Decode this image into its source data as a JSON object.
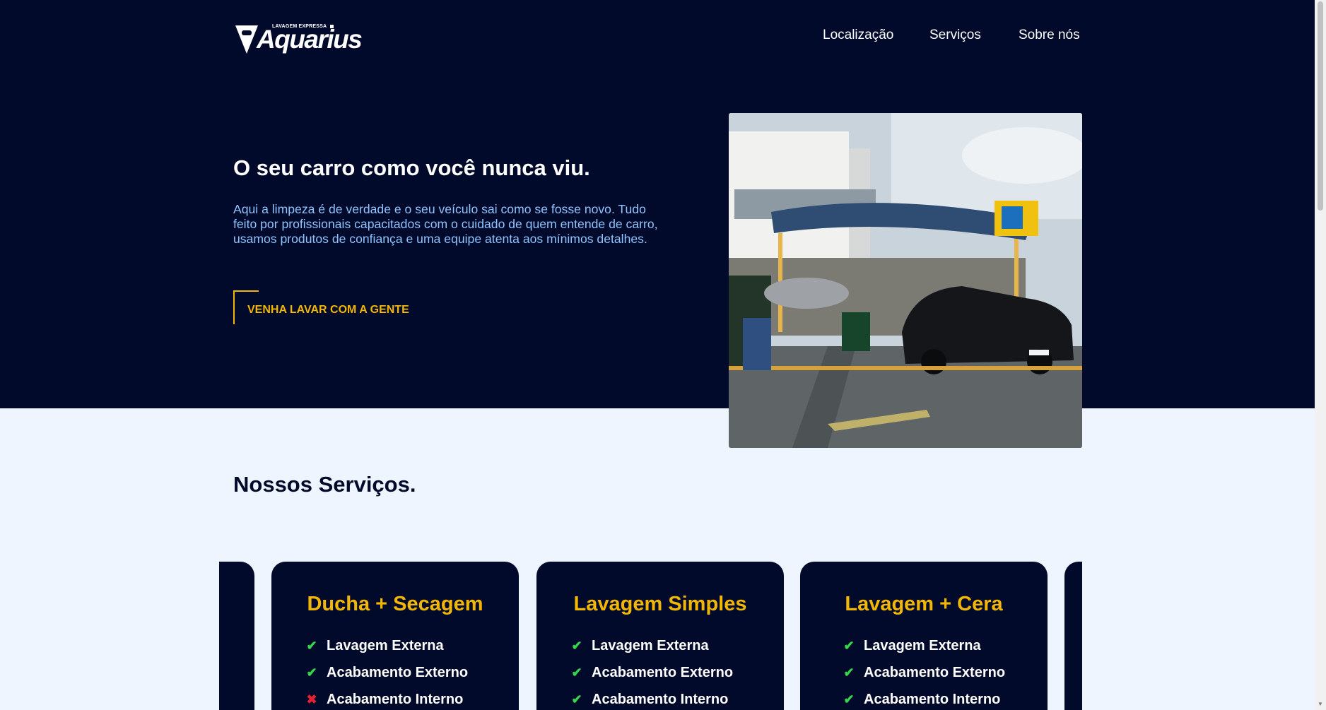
{
  "brand": {
    "logo_small": "LAVAGEM EXPRESSA",
    "logo_big": "Aquarius"
  },
  "nav": {
    "items": [
      {
        "label": "Localização"
      },
      {
        "label": "Serviços"
      },
      {
        "label": "Sobre nós"
      }
    ]
  },
  "hero": {
    "title": "O seu carro como você nunca viu.",
    "text": "Aqui a limpeza é de verdade e o seu veículo sai como se fosse novo. Tudo feito por profissionais capacitados com o cuidado de quem entende de carro, usamos produtos de confiança e uma equipe atenta aos mínimos detalhes.",
    "cta_label": "VENHA LAVAR COM A GENTE"
  },
  "services": {
    "title": "Nossos Serviços.",
    "cards": [
      {
        "title": "Ducha + Secagem",
        "features": [
          {
            "label": "Lavagem Externa",
            "included": true
          },
          {
            "label": "Acabamento Externo",
            "included": true
          },
          {
            "label": "Acabamento Interno",
            "included": false
          }
        ]
      },
      {
        "title": "Lavagem Simples",
        "features": [
          {
            "label": "Lavagem Externa",
            "included": true
          },
          {
            "label": "Acabamento Externo",
            "included": true
          },
          {
            "label": "Acabamento Interno",
            "included": true
          }
        ]
      },
      {
        "title": "Lavagem + Cera",
        "features": [
          {
            "label": "Lavagem Externa",
            "included": true
          },
          {
            "label": "Acabamento Externo",
            "included": true
          },
          {
            "label": "Acabamento Interno",
            "included": true
          }
        ]
      }
    ]
  },
  "colors": {
    "navy": "#020a2b",
    "accent_yellow": "#f2b705",
    "light_blue_text": "#8fc4ff",
    "check_green": "#33d94a",
    "cross_red": "#e3202f",
    "page_bg": "#eef5ff"
  },
  "icons": {
    "included": "check-icon",
    "excluded": "cross-icon"
  }
}
